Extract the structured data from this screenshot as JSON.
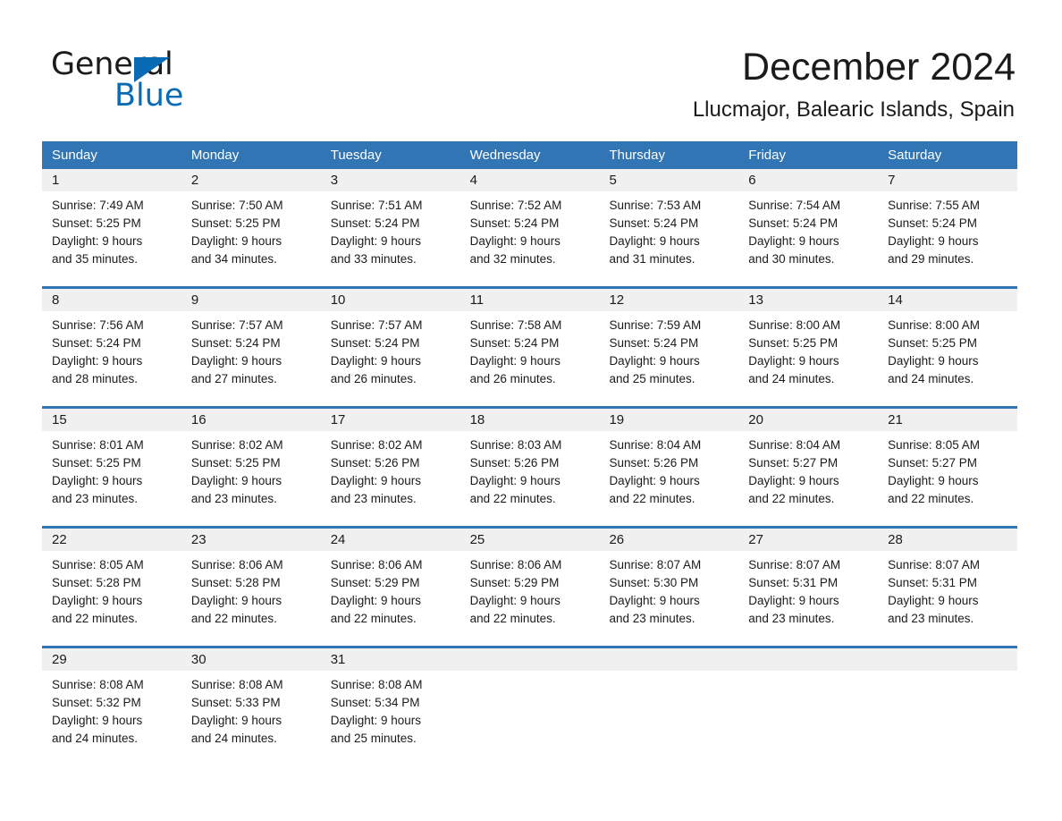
{
  "brand": {
    "line1": "General",
    "line2": "Blue",
    "triangle_color": "#0a6bb5"
  },
  "header": {
    "title": "December 2024",
    "subtitle": "Llucmajor, Balearic Islands, Spain"
  },
  "theme": {
    "header_blue": "#3175b4",
    "daynum_band": "#f0f0f0",
    "text": "#1b1b1b"
  },
  "calendar": {
    "weekdays": [
      "Sunday",
      "Monday",
      "Tuesday",
      "Wednesday",
      "Thursday",
      "Friday",
      "Saturday"
    ],
    "weeks": [
      [
        {
          "day": "1",
          "sunrise": "Sunrise: 7:49 AM",
          "sunset": "Sunset: 5:25 PM",
          "daylight1": "Daylight: 9 hours",
          "daylight2": "and 35 minutes."
        },
        {
          "day": "2",
          "sunrise": "Sunrise: 7:50 AM",
          "sunset": "Sunset: 5:25 PM",
          "daylight1": "Daylight: 9 hours",
          "daylight2": "and 34 minutes."
        },
        {
          "day": "3",
          "sunrise": "Sunrise: 7:51 AM",
          "sunset": "Sunset: 5:24 PM",
          "daylight1": "Daylight: 9 hours",
          "daylight2": "and 33 minutes."
        },
        {
          "day": "4",
          "sunrise": "Sunrise: 7:52 AM",
          "sunset": "Sunset: 5:24 PM",
          "daylight1": "Daylight: 9 hours",
          "daylight2": "and 32 minutes."
        },
        {
          "day": "5",
          "sunrise": "Sunrise: 7:53 AM",
          "sunset": "Sunset: 5:24 PM",
          "daylight1": "Daylight: 9 hours",
          "daylight2": "and 31 minutes."
        },
        {
          "day": "6",
          "sunrise": "Sunrise: 7:54 AM",
          "sunset": "Sunset: 5:24 PM",
          "daylight1": "Daylight: 9 hours",
          "daylight2": "and 30 minutes."
        },
        {
          "day": "7",
          "sunrise": "Sunrise: 7:55 AM",
          "sunset": "Sunset: 5:24 PM",
          "daylight1": "Daylight: 9 hours",
          "daylight2": "and 29 minutes."
        }
      ],
      [
        {
          "day": "8",
          "sunrise": "Sunrise: 7:56 AM",
          "sunset": "Sunset: 5:24 PM",
          "daylight1": "Daylight: 9 hours",
          "daylight2": "and 28 minutes."
        },
        {
          "day": "9",
          "sunrise": "Sunrise: 7:57 AM",
          "sunset": "Sunset: 5:24 PM",
          "daylight1": "Daylight: 9 hours",
          "daylight2": "and 27 minutes."
        },
        {
          "day": "10",
          "sunrise": "Sunrise: 7:57 AM",
          "sunset": "Sunset: 5:24 PM",
          "daylight1": "Daylight: 9 hours",
          "daylight2": "and 26 minutes."
        },
        {
          "day": "11",
          "sunrise": "Sunrise: 7:58 AM",
          "sunset": "Sunset: 5:24 PM",
          "daylight1": "Daylight: 9 hours",
          "daylight2": "and 26 minutes."
        },
        {
          "day": "12",
          "sunrise": "Sunrise: 7:59 AM",
          "sunset": "Sunset: 5:24 PM",
          "daylight1": "Daylight: 9 hours",
          "daylight2": "and 25 minutes."
        },
        {
          "day": "13",
          "sunrise": "Sunrise: 8:00 AM",
          "sunset": "Sunset: 5:25 PM",
          "daylight1": "Daylight: 9 hours",
          "daylight2": "and 24 minutes."
        },
        {
          "day": "14",
          "sunrise": "Sunrise: 8:00 AM",
          "sunset": "Sunset: 5:25 PM",
          "daylight1": "Daylight: 9 hours",
          "daylight2": "and 24 minutes."
        }
      ],
      [
        {
          "day": "15",
          "sunrise": "Sunrise: 8:01 AM",
          "sunset": "Sunset: 5:25 PM",
          "daylight1": "Daylight: 9 hours",
          "daylight2": "and 23 minutes."
        },
        {
          "day": "16",
          "sunrise": "Sunrise: 8:02 AM",
          "sunset": "Sunset: 5:25 PM",
          "daylight1": "Daylight: 9 hours",
          "daylight2": "and 23 minutes."
        },
        {
          "day": "17",
          "sunrise": "Sunrise: 8:02 AM",
          "sunset": "Sunset: 5:26 PM",
          "daylight1": "Daylight: 9 hours",
          "daylight2": "and 23 minutes."
        },
        {
          "day": "18",
          "sunrise": "Sunrise: 8:03 AM",
          "sunset": "Sunset: 5:26 PM",
          "daylight1": "Daylight: 9 hours",
          "daylight2": "and 22 minutes."
        },
        {
          "day": "19",
          "sunrise": "Sunrise: 8:04 AM",
          "sunset": "Sunset: 5:26 PM",
          "daylight1": "Daylight: 9 hours",
          "daylight2": "and 22 minutes."
        },
        {
          "day": "20",
          "sunrise": "Sunrise: 8:04 AM",
          "sunset": "Sunset: 5:27 PM",
          "daylight1": "Daylight: 9 hours",
          "daylight2": "and 22 minutes."
        },
        {
          "day": "21",
          "sunrise": "Sunrise: 8:05 AM",
          "sunset": "Sunset: 5:27 PM",
          "daylight1": "Daylight: 9 hours",
          "daylight2": "and 22 minutes."
        }
      ],
      [
        {
          "day": "22",
          "sunrise": "Sunrise: 8:05 AM",
          "sunset": "Sunset: 5:28 PM",
          "daylight1": "Daylight: 9 hours",
          "daylight2": "and 22 minutes."
        },
        {
          "day": "23",
          "sunrise": "Sunrise: 8:06 AM",
          "sunset": "Sunset: 5:28 PM",
          "daylight1": "Daylight: 9 hours",
          "daylight2": "and 22 minutes."
        },
        {
          "day": "24",
          "sunrise": "Sunrise: 8:06 AM",
          "sunset": "Sunset: 5:29 PM",
          "daylight1": "Daylight: 9 hours",
          "daylight2": "and 22 minutes."
        },
        {
          "day": "25",
          "sunrise": "Sunrise: 8:06 AM",
          "sunset": "Sunset: 5:29 PM",
          "daylight1": "Daylight: 9 hours",
          "daylight2": "and 22 minutes."
        },
        {
          "day": "26",
          "sunrise": "Sunrise: 8:07 AM",
          "sunset": "Sunset: 5:30 PM",
          "daylight1": "Daylight: 9 hours",
          "daylight2": "and 23 minutes."
        },
        {
          "day": "27",
          "sunrise": "Sunrise: 8:07 AM",
          "sunset": "Sunset: 5:31 PM",
          "daylight1": "Daylight: 9 hours",
          "daylight2": "and 23 minutes."
        },
        {
          "day": "28",
          "sunrise": "Sunrise: 8:07 AM",
          "sunset": "Sunset: 5:31 PM",
          "daylight1": "Daylight: 9 hours",
          "daylight2": "and 23 minutes."
        }
      ],
      [
        {
          "day": "29",
          "sunrise": "Sunrise: 8:08 AM",
          "sunset": "Sunset: 5:32 PM",
          "daylight1": "Daylight: 9 hours",
          "daylight2": "and 24 minutes."
        },
        {
          "day": "30",
          "sunrise": "Sunrise: 8:08 AM",
          "sunset": "Sunset: 5:33 PM",
          "daylight1": "Daylight: 9 hours",
          "daylight2": "and 24 minutes."
        },
        {
          "day": "31",
          "sunrise": "Sunrise: 8:08 AM",
          "sunset": "Sunset: 5:34 PM",
          "daylight1": "Daylight: 9 hours",
          "daylight2": "and 25 minutes."
        },
        {
          "day": "",
          "sunrise": "",
          "sunset": "",
          "daylight1": "",
          "daylight2": ""
        },
        {
          "day": "",
          "sunrise": "",
          "sunset": "",
          "daylight1": "",
          "daylight2": ""
        },
        {
          "day": "",
          "sunrise": "",
          "sunset": "",
          "daylight1": "",
          "daylight2": ""
        },
        {
          "day": "",
          "sunrise": "",
          "sunset": "",
          "daylight1": "",
          "daylight2": ""
        }
      ]
    ]
  }
}
